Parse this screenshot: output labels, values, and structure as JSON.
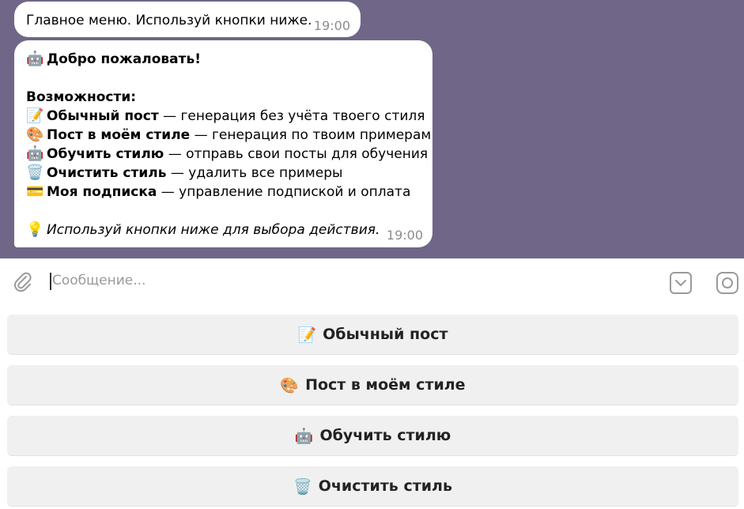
{
  "messages": {
    "short": {
      "text": "Главное меню. Используй кнопки ниже.",
      "time": "19:00"
    },
    "welcome": {
      "title_emoji": "🤖",
      "title": "Добро пожаловать!",
      "section": "Возможности:",
      "features": [
        {
          "emoji": "📝",
          "name": "Обычный пост",
          "desc": " — генерация без учёта твоего стиля"
        },
        {
          "emoji": "🎨",
          "name": "Пост в моём стиле",
          "desc": " — генерация по твоим примерам"
        },
        {
          "emoji": "🤖",
          "name": "Обучить стилю",
          "desc": " — отправь свои посты для обучения"
        },
        {
          "emoji": "🗑️",
          "name": "Очистить стиль",
          "desc": " — удалить все примеры"
        },
        {
          "emoji": "💳",
          "name": "Моя подписка",
          "desc": " — управление подпиской и оплата"
        }
      ],
      "hint_emoji": "💡",
      "hint": "Используй кнопки ниже для выбора действия.",
      "time": "19:00"
    }
  },
  "composer": {
    "placeholder": "Сообщение..."
  },
  "keyboard": [
    {
      "emoji": "📝",
      "label": "Обычный пост"
    },
    {
      "emoji": "🎨",
      "label": "Пост в моём стиле"
    },
    {
      "emoji": "🤖",
      "label": "Обучить стилю"
    },
    {
      "emoji": "🗑️",
      "label": "Очистить стиль"
    }
  ],
  "icons": {
    "attach": "paperclip-icon",
    "keyboard_toggle": "keyboard-toggle-icon",
    "camera": "camera-icon"
  },
  "colors": {
    "chat_background": "#706688",
    "bubble": "#ffffff",
    "keyboard_button": "#f0f0f0"
  }
}
